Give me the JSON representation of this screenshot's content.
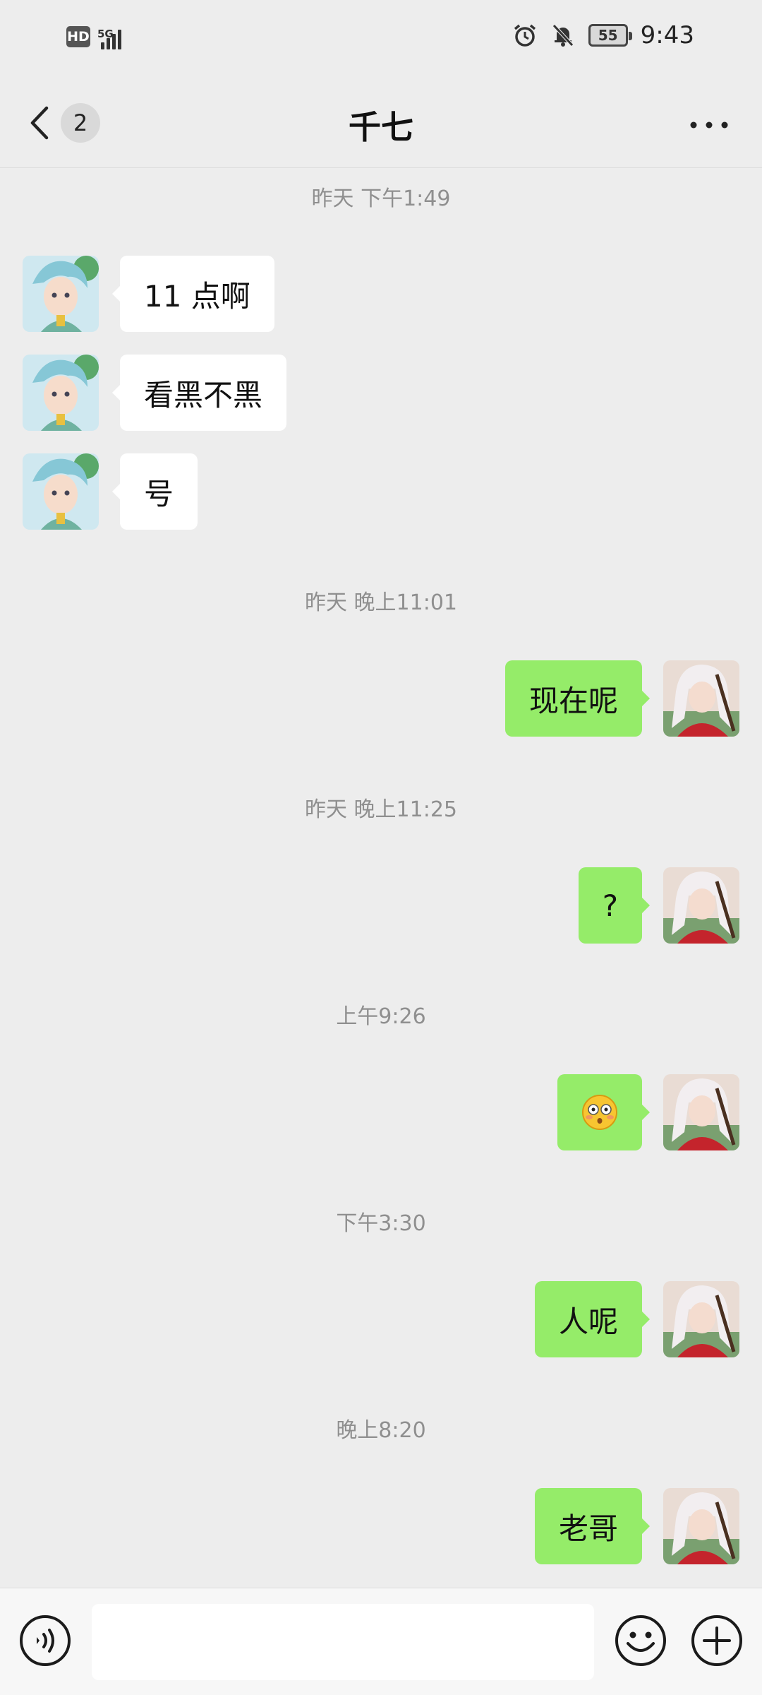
{
  "status_bar": {
    "hd_label": "HD",
    "network_label": "5G",
    "battery_level": "55",
    "time": "9:43"
  },
  "header": {
    "unread_count": "2",
    "title": "千七"
  },
  "messages": [
    {
      "timestamp": "昨天 下午1:49"
    },
    {
      "sender": "contact",
      "text": "11 点啊"
    },
    {
      "sender": "contact",
      "text": "看黑不黑"
    },
    {
      "sender": "contact",
      "text": "号"
    },
    {
      "timestamp": "昨天 晚上11:01"
    },
    {
      "sender": "me",
      "text": "现在呢"
    },
    {
      "timestamp": "昨天 晚上11:25"
    },
    {
      "sender": "me",
      "text": "?"
    },
    {
      "timestamp": "上午9:26"
    },
    {
      "sender": "me",
      "emoji": "flushed-face"
    },
    {
      "timestamp": "下午3:30"
    },
    {
      "sender": "me",
      "text": "人呢"
    },
    {
      "timestamp": "晚上8:20"
    },
    {
      "sender": "me",
      "text": "老哥"
    }
  ],
  "input_bar": {
    "placeholder": "",
    "icons": [
      "voice-icon",
      "emoji-icon",
      "plus-icon"
    ]
  },
  "colors": {
    "background": "#ededed",
    "incoming_bubble": "#ffffff",
    "outgoing_bubble": "#95ec69",
    "timestamp_text": "#8f8f8f"
  }
}
